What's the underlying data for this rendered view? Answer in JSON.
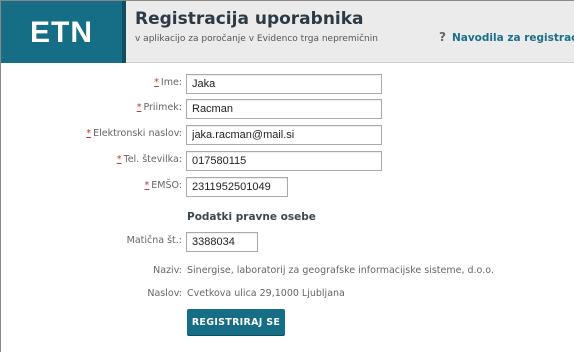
{
  "header": {
    "logo": "ETN",
    "title": "Registracija uporabnika",
    "subtitle": "v aplikacijo za poročanje v Evidenco trga nepremičnin",
    "help_icon": "?",
    "help_link": "Navodila za registracijo"
  },
  "form": {
    "required_marker": "*",
    "fields": [
      {
        "label": "Ime:",
        "value": "Jaka",
        "required": true
      },
      {
        "label": "Priimek:",
        "value": "Racman",
        "required": true
      },
      {
        "label": "Elektronski naslov:",
        "value": "jaka.racman@mail.si",
        "required": true
      },
      {
        "label": "Tel. številka:",
        "value": "017580115",
        "required": true
      },
      {
        "label": "EMŠO:",
        "value": "2311952501049",
        "required": true
      }
    ]
  },
  "legal_entity": {
    "section_title": "Podatki pravne osebe",
    "registration_label": "Matična št.:",
    "registration_value": "3388034",
    "name_label": "Naziv:",
    "name_value": "Sinergise, laboratorij za geografske informacijske sisteme, d.o.o.",
    "address_label": "Naslov:",
    "address_value": "Cvetkova ulica 29,1000 Ljubljana"
  },
  "submit_label": "REGISTRIRAJ SE",
  "colors": {
    "brand": "#156e85",
    "required": "#c0392b",
    "header_bg": "#ebebeb"
  }
}
